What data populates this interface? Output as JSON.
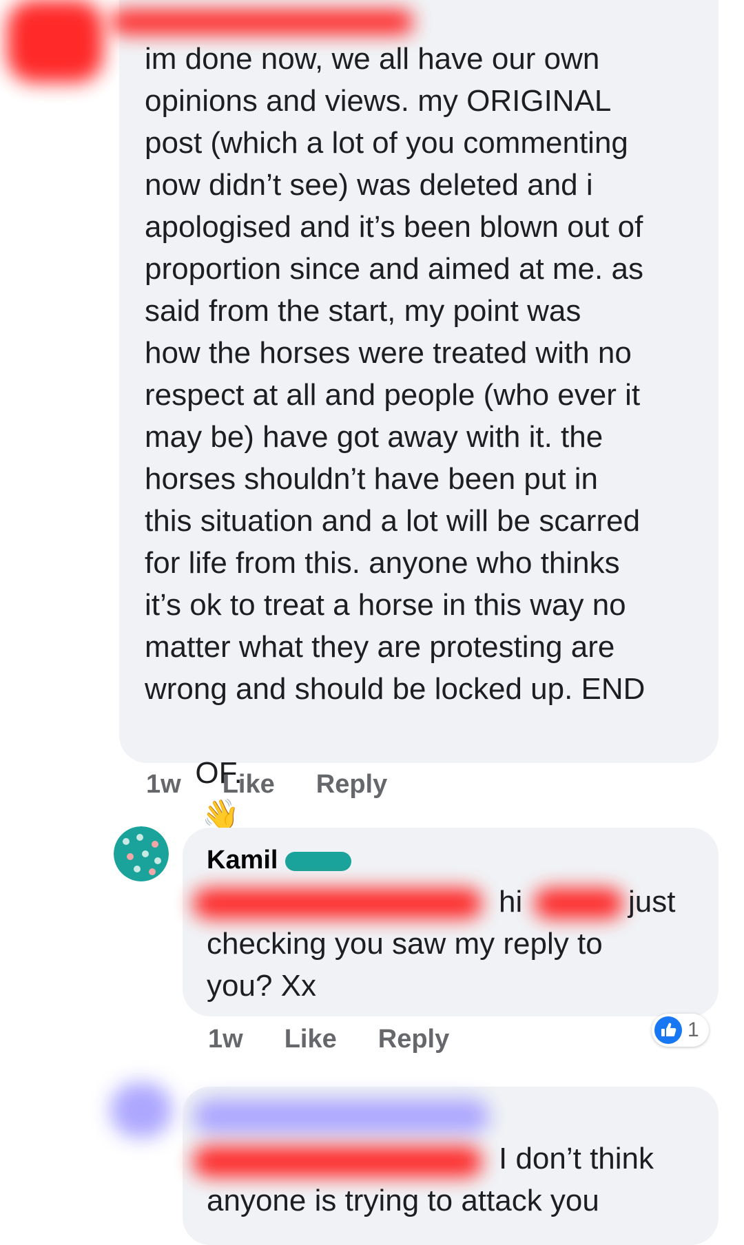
{
  "comment1": {
    "lines": [
      "im done now, we all have our own",
      "opinions and views. my ORIGINAL",
      "post (which a lot of you commenting",
      "now didn’t see) was deleted and i",
      "apologised and it’s been blown out of",
      "proportion since and aimed at me. as",
      "said from the start, my point was",
      "how the horses were treated with no",
      "respect at all and people (who ever it",
      "may be) have got away with it. the",
      "horses shouldn’t have been put in",
      "this situation and a lot will be scarred",
      "for life from this. anyone who thinks",
      "it’s ok to treat a horse in this way no",
      "matter what they are protesting are",
      "wrong and should be locked up. END"
    ],
    "last_line": "OF.",
    "emoji": "👋",
    "time": "1w",
    "like": "Like",
    "reply": "Reply"
  },
  "comment2": {
    "name": "Kamil",
    "line1_a": "hi",
    "line1_b": "just",
    "line2": "checking you saw my reply to",
    "line3": "you? Xx",
    "time": "1w",
    "like": "Like",
    "reply": "Reply",
    "reaction_count": "1"
  },
  "comment3": {
    "line1": "I don’t think",
    "line2": "anyone is trying to attack you"
  }
}
